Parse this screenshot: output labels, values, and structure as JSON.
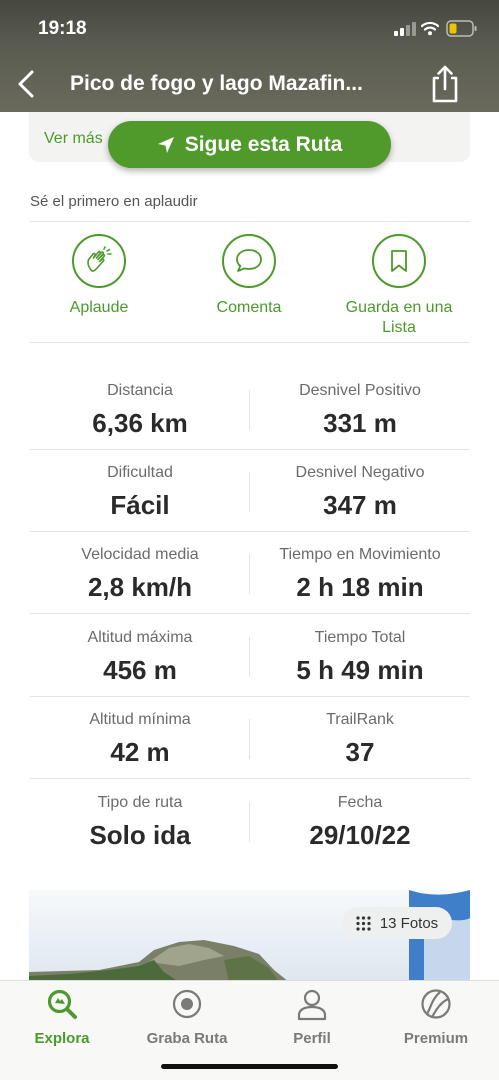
{
  "status_bar": {
    "time": "19:18"
  },
  "header": {
    "title": "Pico de fogo y lago Mazafin...",
    "back_icon": "chevron-left-icon",
    "share_icon": "share-icon"
  },
  "route_card": {
    "ver_mas": "Ver más",
    "follow_button": "Sigue esta Ruta"
  },
  "social": {
    "prompt": "Sé el primero en aplaudir",
    "actions": [
      {
        "label": "Aplaude",
        "icon": "clapping-hands-icon"
      },
      {
        "label": "Comenta",
        "icon": "comment-bubble-icon"
      },
      {
        "label": "Guarda en una Lista",
        "icon": "bookmark-icon"
      }
    ]
  },
  "stats": [
    {
      "left": {
        "label": "Distancia",
        "value": "6,36 km"
      },
      "right": {
        "label": "Desnivel Positivo",
        "value": "331 m"
      }
    },
    {
      "left": {
        "label": "Dificultad",
        "value": "Fácil"
      },
      "right": {
        "label": "Desnivel Negativo",
        "value": "347 m"
      }
    },
    {
      "left": {
        "label": "Velocidad media",
        "value": "2,8 km/h"
      },
      "right": {
        "label": "Tiempo en Movimiento",
        "value": "2 h 18 min"
      }
    },
    {
      "left": {
        "label": "Altitud máxima",
        "value": "456 m"
      },
      "right": {
        "label": "Tiempo Total",
        "value": "5 h 49 min"
      }
    },
    {
      "left": {
        "label": "Altitud mínima",
        "value": "42 m"
      },
      "right": {
        "label": "TrailRank",
        "value": "37"
      }
    },
    {
      "left": {
        "label": "Tipo de ruta",
        "value": "Solo ida"
      },
      "right": {
        "label": "Fecha",
        "value": "29/10/22"
      }
    }
  ],
  "photos": {
    "count_label": "13 Fotos"
  },
  "tabbar": {
    "tabs": [
      {
        "label": "Explora",
        "icon": "search-icon",
        "active": true
      },
      {
        "label": "Graba Ruta",
        "icon": "record-icon",
        "active": false
      },
      {
        "label": "Perfil",
        "icon": "person-icon",
        "active": false
      },
      {
        "label": "Premium",
        "icon": "premium-ball-icon",
        "active": false
      }
    ]
  },
  "colors": {
    "accent": "#4d9a2c",
    "header": "#5c5d52",
    "battery": "#f2c200"
  }
}
